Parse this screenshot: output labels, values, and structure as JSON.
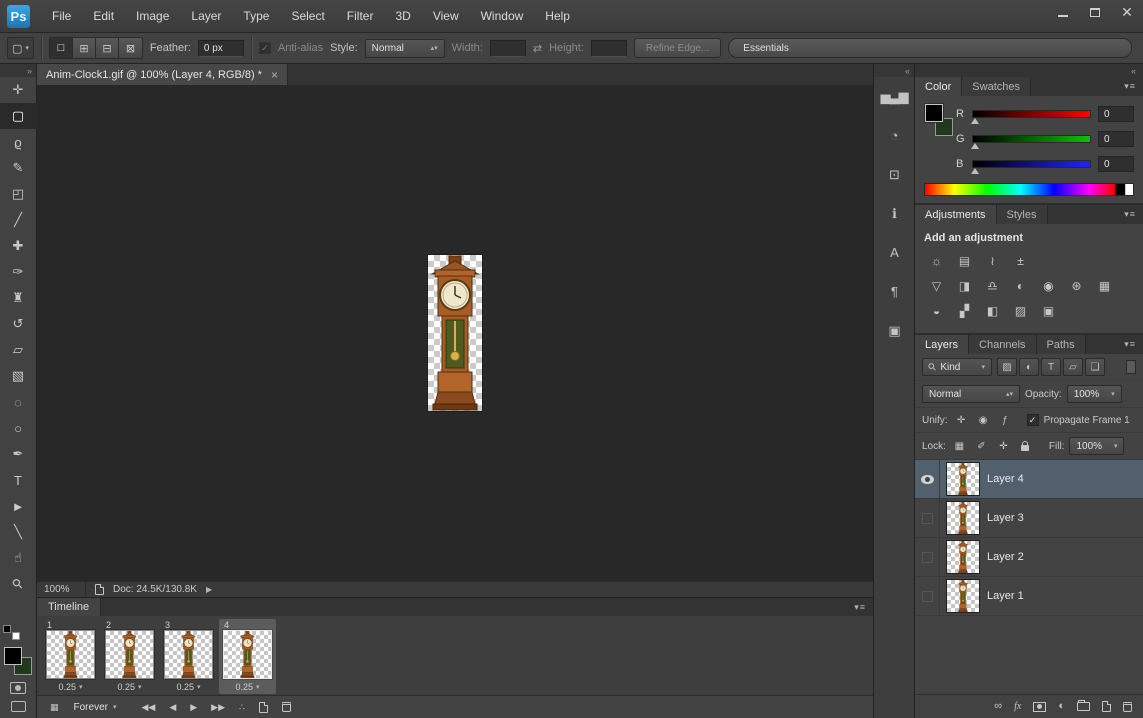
{
  "colors": {
    "logo_blue": "#2b8fd9",
    "canvas_background": "#282828",
    "selected_layer_row": "#52606d",
    "foreground_swatch": "#000000",
    "background_swatch": "#20391d"
  },
  "titlebar": {
    "logo": "Ps",
    "menus": [
      {
        "id": "file",
        "label": "File"
      },
      {
        "id": "edit",
        "label": "Edit"
      },
      {
        "id": "image",
        "label": "Image"
      },
      {
        "id": "layer",
        "label": "Layer"
      },
      {
        "id": "type",
        "label": "Type"
      },
      {
        "id": "select",
        "label": "Select"
      },
      {
        "id": "filter",
        "label": "Filter"
      },
      {
        "id": "3d",
        "label": "3D"
      },
      {
        "id": "view",
        "label": "View"
      },
      {
        "id": "window",
        "label": "Window"
      },
      {
        "id": "help",
        "label": "Help"
      }
    ]
  },
  "options_bar": {
    "feather": {
      "label": "Feather:",
      "value": "0 px"
    },
    "antialias_label": "Anti-alias",
    "style": {
      "label": "Style:",
      "value": "Normal"
    },
    "width": {
      "label": "Width:",
      "value": ""
    },
    "height": {
      "label": "Height:",
      "value": ""
    },
    "refine_edge_label": "Refine Edge...",
    "workspace_label": "Essentials"
  },
  "tools": [
    {
      "id": "move",
      "glyph": "✛"
    },
    {
      "id": "rectangular-marquee",
      "glyph": "▢",
      "selected": true
    },
    {
      "id": "lasso",
      "glyph": "ϱ"
    },
    {
      "id": "quick-selection",
      "glyph": "✎"
    },
    {
      "id": "crop",
      "glyph": "◰"
    },
    {
      "id": "eyedropper",
      "glyph": "╱"
    },
    {
      "id": "spot-healing-brush",
      "glyph": "✚"
    },
    {
      "id": "brush",
      "glyph": "✑"
    },
    {
      "id": "clone-stamp",
      "glyph": "♜"
    },
    {
      "id": "history-brush",
      "glyph": "↺"
    },
    {
      "id": "eraser",
      "glyph": "▱"
    },
    {
      "id": "gradient",
      "glyph": "▧"
    },
    {
      "id": "blur",
      "glyph": "◌"
    },
    {
      "id": "dodge",
      "glyph": "○"
    },
    {
      "id": "pen",
      "glyph": "✒"
    },
    {
      "id": "type",
      "glyph": "T"
    },
    {
      "id": "path-selection",
      "glyph": "►"
    },
    {
      "id": "line-shape",
      "glyph": "╲"
    },
    {
      "id": "hand",
      "glyph": "☝"
    },
    {
      "id": "zoom",
      "glyph": "⚲",
      "rot": true
    }
  ],
  "document": {
    "tab_title": "Anim-Clock1.gif @ 100% (Layer 4, RGB/8) *",
    "status": {
      "zoom": "100%",
      "doc": "Doc: 24.5K/130.8K"
    }
  },
  "timeline": {
    "tab_label": "Timeline",
    "loop_label": "Forever",
    "frames": [
      {
        "number": "1",
        "delay": "0.25"
      },
      {
        "number": "2",
        "delay": "0.25"
      },
      {
        "number": "3",
        "delay": "0.25"
      },
      {
        "number": "4",
        "delay": "0.25",
        "selected": true
      }
    ]
  },
  "side_strip": [
    {
      "id": "histogram",
      "glyph": "▅▃▆"
    },
    {
      "id": "properties",
      "glyph": "◔"
    },
    {
      "id": "clone-source",
      "glyph": "⊡"
    },
    {
      "id": "info",
      "glyph": "ℹ"
    },
    {
      "id": "character",
      "glyph": "A"
    },
    {
      "id": "paragraph",
      "glyph": "¶"
    },
    {
      "id": "3d",
      "glyph": "▣"
    }
  ],
  "panels": {
    "color": {
      "tab_color": "Color",
      "tab_swatches": "Swatches",
      "channels": [
        {
          "label": "R",
          "value": "0"
        },
        {
          "label": "G",
          "value": "0"
        },
        {
          "label": "B",
          "value": "0"
        }
      ]
    },
    "adjustments": {
      "tab_adjustments": "Adjustments",
      "tab_styles": "Styles",
      "header": "Add an adjustment",
      "icons_row1": [
        {
          "id": "brightness-contrast",
          "glyph": "☼"
        },
        {
          "id": "levels",
          "glyph": "▤"
        },
        {
          "id": "curves",
          "glyph": "≀"
        },
        {
          "id": "exposure",
          "glyph": "±"
        }
      ],
      "icons_row2": [
        {
          "id": "vibrance",
          "glyph": "▽"
        },
        {
          "id": "hue-saturation",
          "glyph": "◨"
        },
        {
          "id": "color-balance",
          "glyph": "♎"
        },
        {
          "id": "black-white",
          "glyph": "◐"
        },
        {
          "id": "photo-filter",
          "glyph": "◉"
        },
        {
          "id": "channel-mixer",
          "glyph": "⊛"
        },
        {
          "id": "color-lookup",
          "glyph": "▦"
        }
      ],
      "icons_row3": [
        {
          "id": "invert",
          "glyph": "◒"
        },
        {
          "id": "posterize",
          "glyph": "▞"
        },
        {
          "id": "threshold",
          "glyph": "◧"
        },
        {
          "id": "gradient-map",
          "glyph": "▨"
        },
        {
          "id": "selective-color",
          "glyph": "▣"
        }
      ]
    },
    "layers": {
      "tab_layers": "Layers",
      "tab_channels": "Channels",
      "tab_paths": "Paths",
      "kind_label": "Kind",
      "filter_icons": [
        {
          "id": "pixel-layer",
          "glyph": "▨"
        },
        {
          "id": "adjustment-layer",
          "glyph": "◐"
        },
        {
          "id": "type-layer",
          "glyph": "T"
        },
        {
          "id": "shape-layer",
          "glyph": "▱"
        },
        {
          "id": "smart-object",
          "glyph": "❏"
        }
      ],
      "blend_mode": "Normal",
      "opacity_label": "Opacity:",
      "opacity_value": "100%",
      "unify_label": "Unify:",
      "propagate_label": "Propagate Frame 1",
      "lock_label": "Lock:",
      "fill_label": "Fill:",
      "fill_value": "100%",
      "items": [
        {
          "name": "Layer 4",
          "selected": true,
          "visible": true
        },
        {
          "name": "Layer 3",
          "selected": false,
          "visible": false
        },
        {
          "name": "Layer 2",
          "selected": false,
          "visible": false
        },
        {
          "name": "Layer 1",
          "selected": false,
          "visible": false
        }
      ]
    }
  }
}
